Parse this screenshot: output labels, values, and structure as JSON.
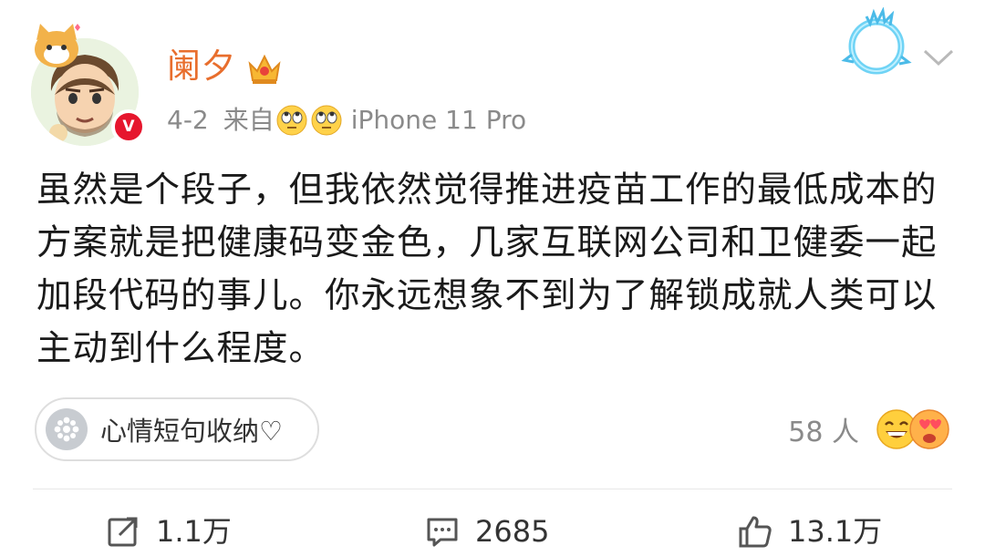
{
  "post": {
    "username": "阑夕",
    "date": "4-2",
    "source_prefix": "来自",
    "device": "iPhone 11 Pro",
    "content": "虽然是个段子，但我依然觉得推进疫苗工作的最低成本的方案就是把健康码变金色，几家互联网公司和卫健委一起加段代码的事儿。你永远想象不到为了解锁成就人类可以主动到什么程度。",
    "tag": "心情短句收纳♡",
    "likers_count": "58 人"
  },
  "actions": {
    "forward": "1.1万",
    "comment": "2685",
    "like": "13.1万"
  },
  "colors": {
    "username": "#e86e2d",
    "verified": "#e6162d",
    "meta": "#8a8a8a"
  },
  "icons": [
    "avatar",
    "verified-badge-icon",
    "crown-icon",
    "rolling-eyes-emoji-icon",
    "ring-decoration-icon",
    "chevron-down-icon",
    "tag-icon",
    "laughing-emoji-icon",
    "heart-eyes-emoji-icon",
    "forward-icon",
    "comment-icon",
    "like-icon"
  ]
}
